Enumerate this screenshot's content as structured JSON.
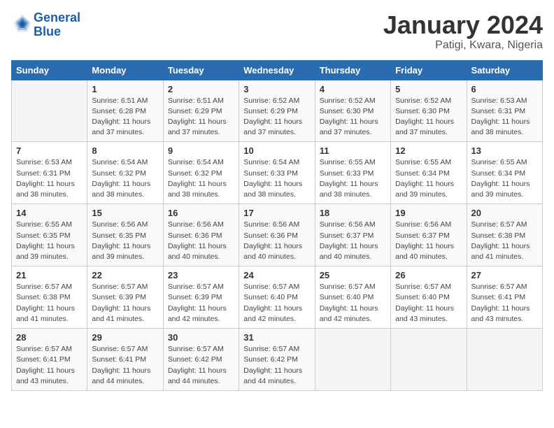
{
  "header": {
    "logo_general": "General",
    "logo_blue": "Blue",
    "month": "January 2024",
    "location": "Patigi, Kwara, Nigeria"
  },
  "days_of_week": [
    "Sunday",
    "Monday",
    "Tuesday",
    "Wednesday",
    "Thursday",
    "Friday",
    "Saturday"
  ],
  "weeks": [
    [
      {
        "day": "",
        "sunrise": "",
        "sunset": "",
        "daylight": ""
      },
      {
        "day": "1",
        "sunrise": "Sunrise: 6:51 AM",
        "sunset": "Sunset: 6:28 PM",
        "daylight": "Daylight: 11 hours and 37 minutes."
      },
      {
        "day": "2",
        "sunrise": "Sunrise: 6:51 AM",
        "sunset": "Sunset: 6:29 PM",
        "daylight": "Daylight: 11 hours and 37 minutes."
      },
      {
        "day": "3",
        "sunrise": "Sunrise: 6:52 AM",
        "sunset": "Sunset: 6:29 PM",
        "daylight": "Daylight: 11 hours and 37 minutes."
      },
      {
        "day": "4",
        "sunrise": "Sunrise: 6:52 AM",
        "sunset": "Sunset: 6:30 PM",
        "daylight": "Daylight: 11 hours and 37 minutes."
      },
      {
        "day": "5",
        "sunrise": "Sunrise: 6:52 AM",
        "sunset": "Sunset: 6:30 PM",
        "daylight": "Daylight: 11 hours and 37 minutes."
      },
      {
        "day": "6",
        "sunrise": "Sunrise: 6:53 AM",
        "sunset": "Sunset: 6:31 PM",
        "daylight": "Daylight: 11 hours and 38 minutes."
      }
    ],
    [
      {
        "day": "7",
        "sunrise": "Sunrise: 6:53 AM",
        "sunset": "Sunset: 6:31 PM",
        "daylight": "Daylight: 11 hours and 38 minutes."
      },
      {
        "day": "8",
        "sunrise": "Sunrise: 6:54 AM",
        "sunset": "Sunset: 6:32 PM",
        "daylight": "Daylight: 11 hours and 38 minutes."
      },
      {
        "day": "9",
        "sunrise": "Sunrise: 6:54 AM",
        "sunset": "Sunset: 6:32 PM",
        "daylight": "Daylight: 11 hours and 38 minutes."
      },
      {
        "day": "10",
        "sunrise": "Sunrise: 6:54 AM",
        "sunset": "Sunset: 6:33 PM",
        "daylight": "Daylight: 11 hours and 38 minutes."
      },
      {
        "day": "11",
        "sunrise": "Sunrise: 6:55 AM",
        "sunset": "Sunset: 6:33 PM",
        "daylight": "Daylight: 11 hours and 38 minutes."
      },
      {
        "day": "12",
        "sunrise": "Sunrise: 6:55 AM",
        "sunset": "Sunset: 6:34 PM",
        "daylight": "Daylight: 11 hours and 39 minutes."
      },
      {
        "day": "13",
        "sunrise": "Sunrise: 6:55 AM",
        "sunset": "Sunset: 6:34 PM",
        "daylight": "Daylight: 11 hours and 39 minutes."
      }
    ],
    [
      {
        "day": "14",
        "sunrise": "Sunrise: 6:55 AM",
        "sunset": "Sunset: 6:35 PM",
        "daylight": "Daylight: 11 hours and 39 minutes."
      },
      {
        "day": "15",
        "sunrise": "Sunrise: 6:56 AM",
        "sunset": "Sunset: 6:35 PM",
        "daylight": "Daylight: 11 hours and 39 minutes."
      },
      {
        "day": "16",
        "sunrise": "Sunrise: 6:56 AM",
        "sunset": "Sunset: 6:36 PM",
        "daylight": "Daylight: 11 hours and 40 minutes."
      },
      {
        "day": "17",
        "sunrise": "Sunrise: 6:56 AM",
        "sunset": "Sunset: 6:36 PM",
        "daylight": "Daylight: 11 hours and 40 minutes."
      },
      {
        "day": "18",
        "sunrise": "Sunrise: 6:56 AM",
        "sunset": "Sunset: 6:37 PM",
        "daylight": "Daylight: 11 hours and 40 minutes."
      },
      {
        "day": "19",
        "sunrise": "Sunrise: 6:56 AM",
        "sunset": "Sunset: 6:37 PM",
        "daylight": "Daylight: 11 hours and 40 minutes."
      },
      {
        "day": "20",
        "sunrise": "Sunrise: 6:57 AM",
        "sunset": "Sunset: 6:38 PM",
        "daylight": "Daylight: 11 hours and 41 minutes."
      }
    ],
    [
      {
        "day": "21",
        "sunrise": "Sunrise: 6:57 AM",
        "sunset": "Sunset: 6:38 PM",
        "daylight": "Daylight: 11 hours and 41 minutes."
      },
      {
        "day": "22",
        "sunrise": "Sunrise: 6:57 AM",
        "sunset": "Sunset: 6:39 PM",
        "daylight": "Daylight: 11 hours and 41 minutes."
      },
      {
        "day": "23",
        "sunrise": "Sunrise: 6:57 AM",
        "sunset": "Sunset: 6:39 PM",
        "daylight": "Daylight: 11 hours and 42 minutes."
      },
      {
        "day": "24",
        "sunrise": "Sunrise: 6:57 AM",
        "sunset": "Sunset: 6:40 PM",
        "daylight": "Daylight: 11 hours and 42 minutes."
      },
      {
        "day": "25",
        "sunrise": "Sunrise: 6:57 AM",
        "sunset": "Sunset: 6:40 PM",
        "daylight": "Daylight: 11 hours and 42 minutes."
      },
      {
        "day": "26",
        "sunrise": "Sunrise: 6:57 AM",
        "sunset": "Sunset: 6:40 PM",
        "daylight": "Daylight: 11 hours and 43 minutes."
      },
      {
        "day": "27",
        "sunrise": "Sunrise: 6:57 AM",
        "sunset": "Sunset: 6:41 PM",
        "daylight": "Daylight: 11 hours and 43 minutes."
      }
    ],
    [
      {
        "day": "28",
        "sunrise": "Sunrise: 6:57 AM",
        "sunset": "Sunset: 6:41 PM",
        "daylight": "Daylight: 11 hours and 43 minutes."
      },
      {
        "day": "29",
        "sunrise": "Sunrise: 6:57 AM",
        "sunset": "Sunset: 6:41 PM",
        "daylight": "Daylight: 11 hours and 44 minutes."
      },
      {
        "day": "30",
        "sunrise": "Sunrise: 6:57 AM",
        "sunset": "Sunset: 6:42 PM",
        "daylight": "Daylight: 11 hours and 44 minutes."
      },
      {
        "day": "31",
        "sunrise": "Sunrise: 6:57 AM",
        "sunset": "Sunset: 6:42 PM",
        "daylight": "Daylight: 11 hours and 44 minutes."
      },
      {
        "day": "",
        "sunrise": "",
        "sunset": "",
        "daylight": ""
      },
      {
        "day": "",
        "sunrise": "",
        "sunset": "",
        "daylight": ""
      },
      {
        "day": "",
        "sunrise": "",
        "sunset": "",
        "daylight": ""
      }
    ]
  ]
}
